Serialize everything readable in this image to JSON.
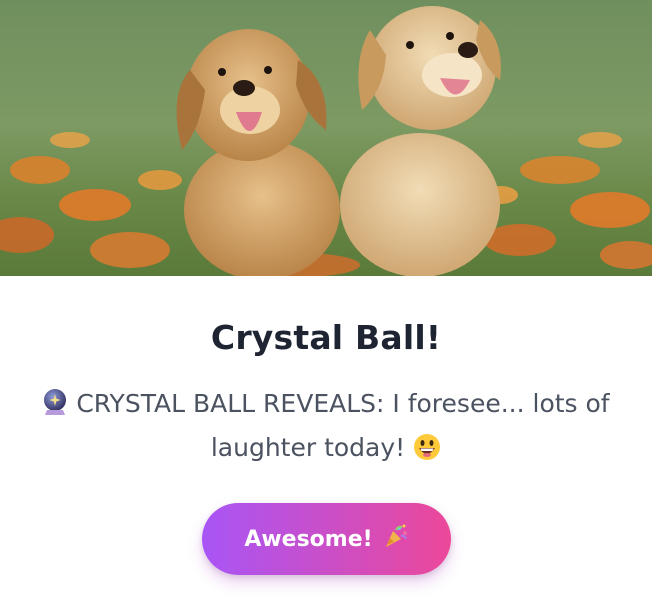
{
  "card": {
    "title": "Crystal Ball!",
    "message_icon": "crystal-ball-icon",
    "message_text": "CRYSTAL BALL REVEALS: I foresee... lots of laughter today!",
    "message_emoji": "grinning-face-icon",
    "button_label": "Awesome!",
    "button_icon": "party-popper-icon"
  },
  "hero_image": {
    "subject": "two golden retriever puppies sitting in an orange flower field"
  },
  "colors": {
    "title": "#1f2433",
    "message": "#4b5260",
    "button_gradient_start": "#a855f7",
    "button_gradient_end": "#ec4899"
  }
}
